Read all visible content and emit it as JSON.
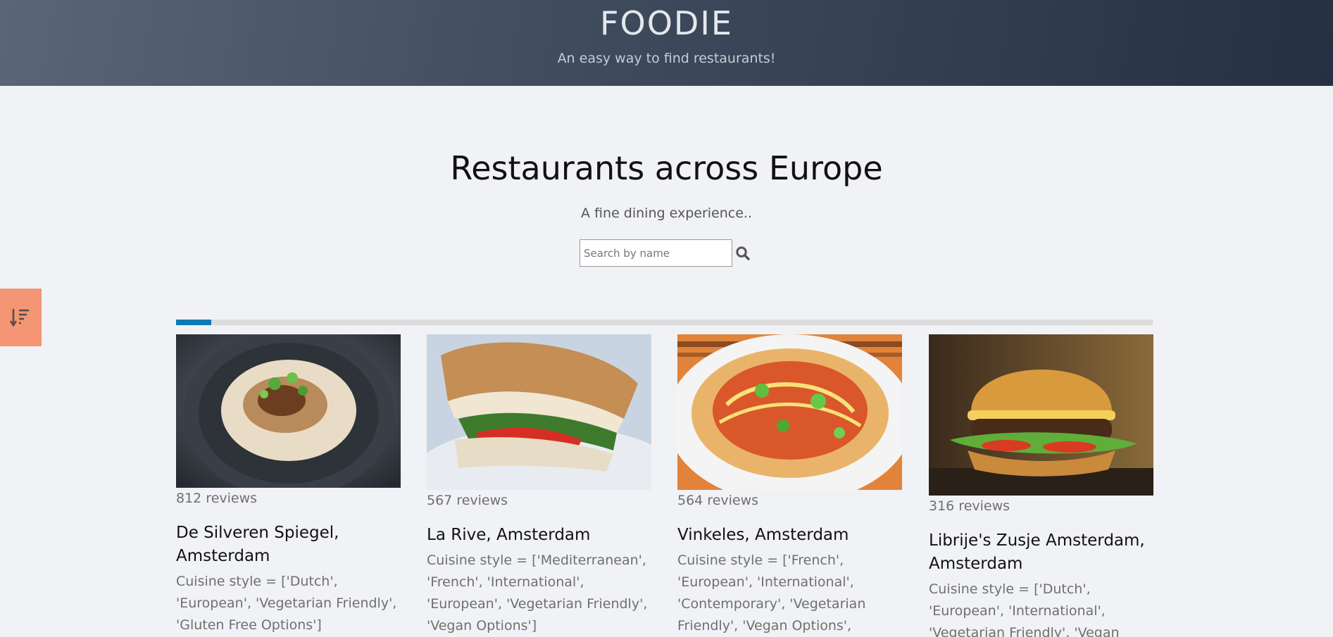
{
  "header": {
    "title": "FOODIE",
    "tagline": "An easy way to find restaurants!"
  },
  "hero": {
    "title": "Restaurants across Europe",
    "subtitle": "A fine dining experience.."
  },
  "search": {
    "placeholder": "Search by name",
    "value": "",
    "icon": "search-icon"
  },
  "sort": {
    "icon": "sort-descending-icon",
    "color": "#f49673"
  },
  "progress": {
    "fraction": 0.036,
    "color": "#1279b7"
  },
  "restaurants": [
    {
      "reviews": "812 reviews",
      "name": "De Silveren Spiegel, Amsterdam",
      "cuisine": "Cuisine style = ['Dutch', 'European', 'Vegetarian Friendly', 'Gluten Free Options']",
      "image": "rice-dish-photo"
    },
    {
      "reviews": "567 reviews",
      "name": "La Rive, Amsterdam",
      "cuisine": "Cuisine style = ['Mediterranean', 'French', 'International', 'European', 'Vegetarian Friendly', 'Vegan Options']",
      "image": "sandwich-photo"
    },
    {
      "reviews": "564 reviews",
      "name": "Vinkeles, Amsterdam",
      "cuisine": "Cuisine style = ['French', 'European', 'International', 'Contemporary', 'Vegetarian Friendly', 'Vegan Options', 'Gluten",
      "image": "noodle-bowl-photo"
    },
    {
      "reviews": "316 reviews",
      "name": "Librije's Zusje Amsterdam, Amsterdam",
      "cuisine": "Cuisine style = ['Dutch', 'European', 'International', 'Vegetarian Friendly', 'Vegan",
      "image": "burger-photo"
    }
  ]
}
